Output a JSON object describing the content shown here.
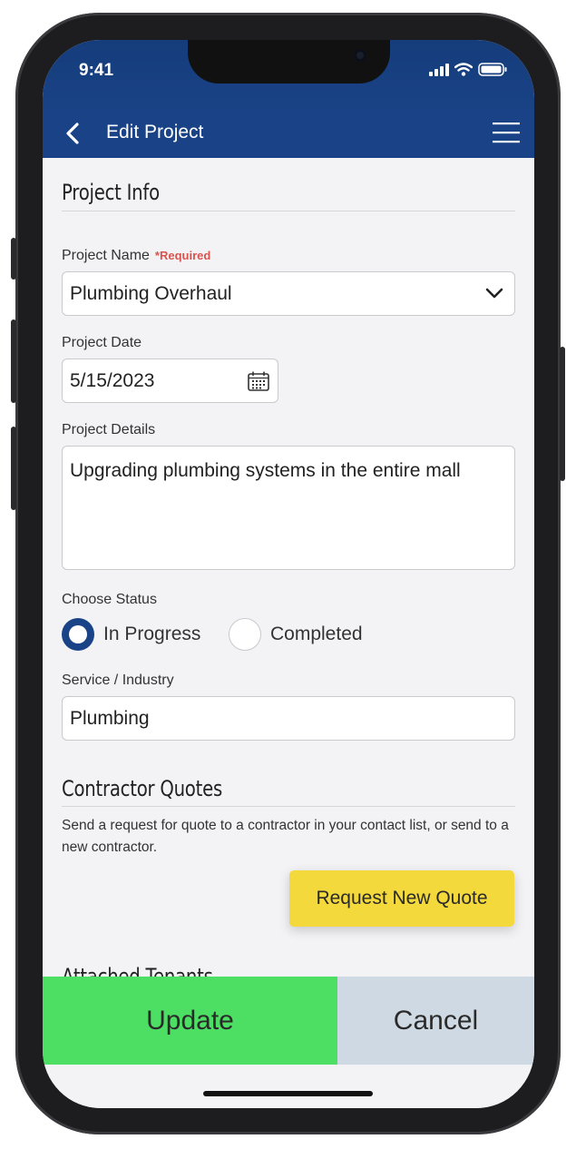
{
  "status_bar": {
    "time": "9:41"
  },
  "app_bar": {
    "title": "Edit Project"
  },
  "project_info": {
    "heading": "Project Info",
    "name_label": "Project Name",
    "required_tag": "*Required",
    "name_value": "Plumbing Overhaul",
    "date_label": "Project Date",
    "date_value": "5/15/2023",
    "details_label": "Project Details",
    "details_value": "Upgrading plumbing systems in the entire mall",
    "status_label": "Choose Status",
    "status_options": [
      {
        "label": "In Progress",
        "selected": true
      },
      {
        "label": "Completed",
        "selected": false
      }
    ],
    "service_label": "Service / Industry",
    "service_value": "Plumbing"
  },
  "contractor_quotes": {
    "heading": "Contractor Quotes",
    "description": "Send a request for quote to a contractor in your contact list, or send to a new contractor.",
    "request_button": "Request New Quote"
  },
  "attached_tenants": {
    "heading": "Attached Tenants"
  },
  "footer": {
    "update_label": "Update",
    "cancel_label": "Cancel"
  },
  "icons": {
    "back": "chevron-left-icon",
    "menu": "hamburger-menu-icon",
    "dropdown": "chevron-down-icon",
    "calendar": "calendar-icon"
  },
  "colors": {
    "header": "#1a4387",
    "update_button": "#4cdf63",
    "cancel_button": "#cfd9e3",
    "quote_button": "#f3d93b",
    "required": "#d9534f"
  }
}
